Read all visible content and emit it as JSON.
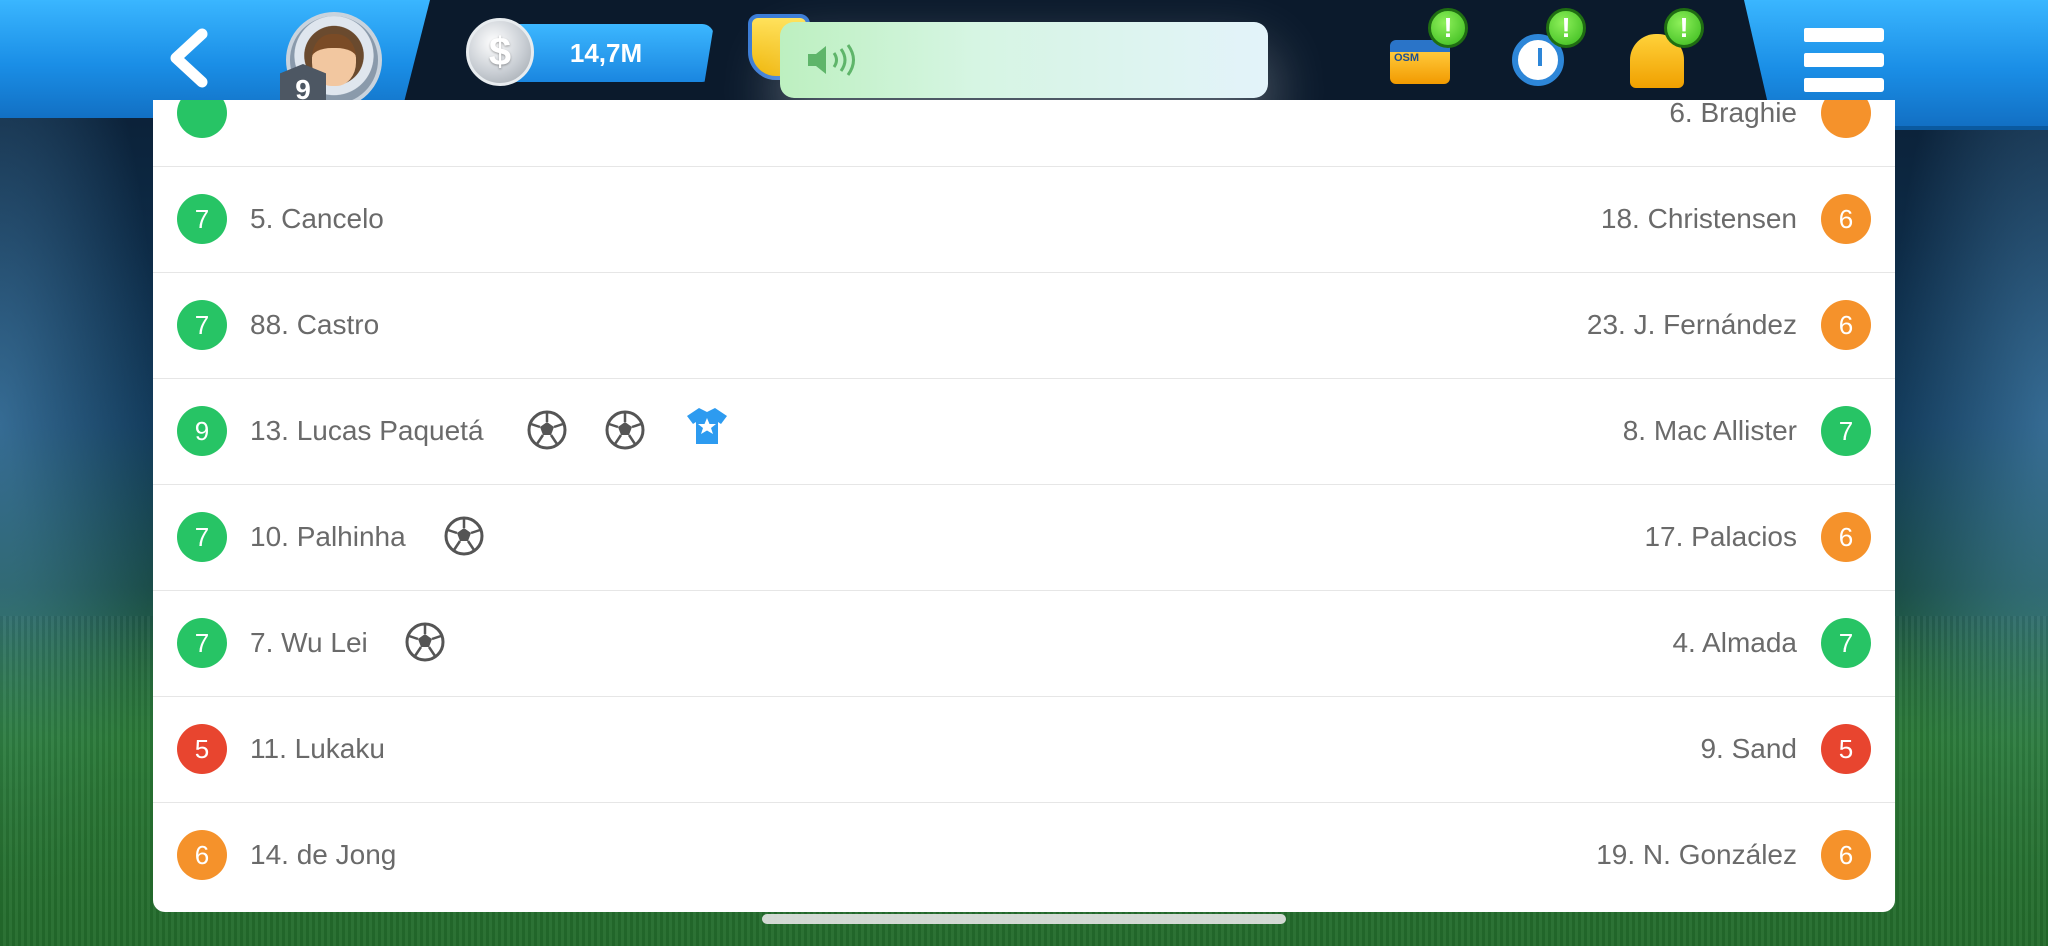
{
  "header": {
    "coins": "14,7M",
    "coin_symbol": "$",
    "manager_level": "9",
    "case_label": "OSM",
    "alert_mark": "!"
  },
  "rows": [
    {
      "left_rating": "",
      "left_name": "",
      "right_name": "6. Braghie",
      "right_rating": ""
    },
    {
      "left_rating": "7",
      "left_name": "5. Cancelo",
      "right_name": "18. Christensen",
      "right_rating": "6"
    },
    {
      "left_rating": "7",
      "left_name": "88. Castro",
      "right_name": "23. J. Fernández",
      "right_rating": "6"
    },
    {
      "left_rating": "9",
      "left_name": "13. Lucas Paquetá",
      "right_name": "8. Mac Allister",
      "right_rating": "7"
    },
    {
      "left_rating": "7",
      "left_name": "10. Palhinha",
      "right_name": "17. Palacios",
      "right_rating": "6"
    },
    {
      "left_rating": "7",
      "left_name": "7. Wu Lei",
      "right_name": "4. Almada",
      "right_rating": "7"
    },
    {
      "left_rating": "5",
      "left_name": "11. Lukaku",
      "right_name": "9. Sand",
      "right_rating": "5"
    },
    {
      "left_rating": "6",
      "left_name": "14. de Jong",
      "right_name": "19. N. González",
      "right_rating": "6"
    }
  ],
  "colors": {
    "rating_green": "#27c465",
    "rating_orange": "#f5922b",
    "rating_red": "#e8452f",
    "accent_blue": "#1a8ee6"
  },
  "icons": {
    "back": "chevron-left-icon",
    "goal": "soccer-ball-icon",
    "motm": "star-shirt-icon",
    "menu": "list-menu-icon",
    "volume": "speaker-icon"
  }
}
